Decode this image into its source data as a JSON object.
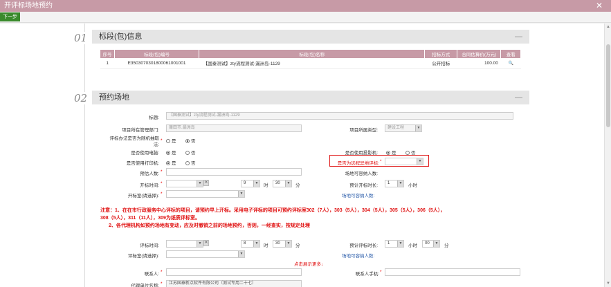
{
  "window": {
    "title": "开评标场地预约",
    "close_glyph": "✕"
  },
  "toolbar": {
    "next_label": "下一步"
  },
  "section1": {
    "num": "01",
    "title": "标段(包)信息",
    "collapse_glyph": "—",
    "table": {
      "headers": [
        "序号",
        "标段(包)编号",
        "标段(包)名称",
        "招标方式",
        "合同估算价(万元)",
        "查看"
      ],
      "rows": [
        [
          "1",
          "E3503070301800061001001",
          "【国泰测试】zty流程测试-漏洲岛-1129",
          "公开招标",
          "100.00",
          "🔍"
        ]
      ]
    }
  },
  "section2": {
    "num": "02",
    "title": "预约场地",
    "collapse_glyph": "—"
  },
  "form": {
    "title_label": "标题:",
    "title_value": "【国泰测试】zty流程测试-漏洲岛-1129",
    "dept_label": "项目所在管理部门:",
    "dept_value": "莆田市.漏洲岛",
    "type_label": "项目所属类型:",
    "type_value": "建设工程",
    "random_label_1": "评标办法是否为随机抽取",
    "random_label_2": "法:",
    "yes": "是",
    "no": "否",
    "computer_label": "是否使用电脑:",
    "projector_label": "是否使用投影机:",
    "printer_label": "是否使用打印机:",
    "remote_label": "是否为远程异地评标:",
    "people_label": "预估人数:",
    "capacity_label": "场地可容纳人数:",
    "open_time_label": "开标时间:",
    "hour_val": "9",
    "hour_unit": "时",
    "min_val": "30",
    "min_unit": "分",
    "open_duration_label": "预计开标时长:",
    "duration_val": "1",
    "duration_unit": "小时",
    "open_room_label": "开标室(请选择):",
    "capacity_link": "场地可容纳人数:",
    "eval_time_label": "评标时间:",
    "eval_hour_val": "8",
    "eval_min_val": "30",
    "eval_duration_label": "预计评标时长:",
    "eval_duration_val": "1",
    "eval_duration_hour": "小时",
    "eval_duration_min": "00",
    "eval_duration_min_unit": "分",
    "eval_room_label": "评标室(请选择):",
    "eval_capacity_label": "场地可容纳人数:",
    "expand_more": "点击展示更多↓",
    "contact_label": "联系人:",
    "contact_phone_label": "联系人手机:",
    "agency_label": "代理单位名称:",
    "agency_value": "江苏国泰新点软件有限公司（测试专用二十七）"
  },
  "notice": {
    "line1": "注意：1、在在市行政服务中心评标的项目，请预约早上开标。采用电子评标的项目可预约评标室302（7人），303（5人），304（5人），305（5人），306（5人），",
    "line2": "308（5人），311（11人），309为纸质评标室。",
    "line3": "2、各代理机构如预约场地有变动，应及时撤销之前的场地预约，否则，一经查实，按规定处理"
  }
}
